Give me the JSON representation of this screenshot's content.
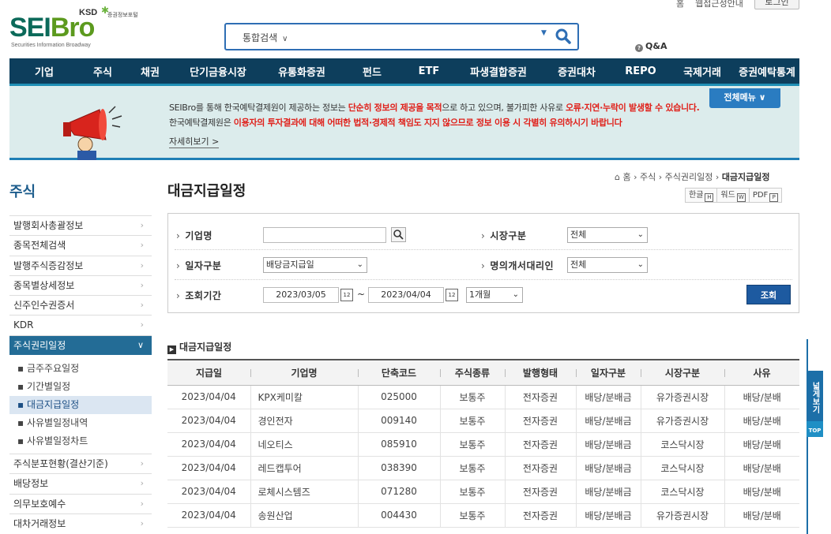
{
  "header": {
    "logo_main_a": "SEI",
    "logo_main_b": "Bro",
    "logo_sub": "Securities Information Broadway",
    "logo_ksd": "KSD",
    "logo_portal": "증권정보포털",
    "top_links": [
      "홈",
      "웹접근성안내"
    ],
    "login": "로그인",
    "search_type": "통합검색",
    "qna": "Q&A"
  },
  "nav": [
    "기업",
    "주식",
    "채권",
    "단기금융시장",
    "유통화증권",
    "펀드",
    "ETF",
    "파생결합증권",
    "증권대차",
    "REPO",
    "국제거래",
    "증권예탁통계"
  ],
  "banner": {
    "line1_a": "SEIBro를 통해 한국예탁결제원이 제공하는 정보는 ",
    "line1_b": "단순히 정보의 제공을 목적",
    "line1_c": "으로 하고 있으며, 불가피한 사유로 ",
    "line1_d": "오류·지연·누락이 발생할 수 있습니다.",
    "line2_a": "한국예탁결제원은 ",
    "line2_b": "이용자의 투자결과에 대해 어떠한 법적·경제적 책임도 지지 않으므로 정보 이용 시 각별히 유의하시기 바랍니다",
    "more": "자세히보기  >",
    "all_menu": "전체메뉴  ∨"
  },
  "sidebar": {
    "title": "주식",
    "items_top": [
      "발행회사총괄정보",
      "종목전체검색",
      "발행주식증감정보",
      "종목별상세정보",
      "신주인수권증서",
      "KDR"
    ],
    "active": "주식권리일정",
    "sub_items": [
      "금주주요일정",
      "기간별일정",
      "대금지급일정",
      "사유별일정내역",
      "사유별일정차트"
    ],
    "sub_active_index": 2,
    "items_bottom": [
      "주식분포현황(결산기준)",
      "배당정보",
      "의무보호예수",
      "대차거래정보"
    ]
  },
  "main": {
    "title": "대금지급일정",
    "breadcrumb": [
      "홈",
      "주식",
      "주식권리일정",
      "대금지급일정"
    ],
    "export": [
      "한글",
      "워드",
      "PDF"
    ]
  },
  "filter": {
    "company_label": "기업명",
    "company_value": "",
    "market_label": "시장구분",
    "market_value": "전체",
    "date_type_label": "일자구분",
    "date_type_value": "배당금지급일",
    "agent_label": "명의개서대리인",
    "agent_value": "전체",
    "period_label": "조회기간",
    "date_from": "2023/03/05",
    "date_to": "2023/04/04",
    "tilde": "~",
    "range": "1개월",
    "submit": "조회"
  },
  "table": {
    "section_title": "대금지급일정",
    "headers": [
      "지급일",
      "기업명",
      "단축코드",
      "주식종류",
      "발행형태",
      "일자구분",
      "시장구분",
      "사유"
    ],
    "rows": [
      [
        "2023/04/04",
        "KPX케미칼",
        "025000",
        "보통주",
        "전자증권",
        "배당/분배금",
        "유가증권시장",
        "배당/분배"
      ],
      [
        "2023/04/04",
        "경인전자",
        "009140",
        "보통주",
        "전자증권",
        "배당/분배금",
        "유가증권시장",
        "배당/분배"
      ],
      [
        "2023/04/04",
        "네오티스",
        "085910",
        "보통주",
        "전자증권",
        "배당/분배금",
        "코스닥시장",
        "배당/분배"
      ],
      [
        "2023/04/04",
        "레드캡투어",
        "038390",
        "보통주",
        "전자증권",
        "배당/분배금",
        "코스닥시장",
        "배당/분배"
      ],
      [
        "2023/04/04",
        "로체시스템즈",
        "071280",
        "보통주",
        "전자증권",
        "배당/분배금",
        "코스닥시장",
        "배당/분배"
      ],
      [
        "2023/04/04",
        "송원산업",
        "004430",
        "보통주",
        "전자증권",
        "배당/분배금",
        "유가증권시장",
        "배당/분배"
      ]
    ]
  },
  "floating": {
    "wide_view": "넓게보기",
    "top": "TOP"
  }
}
